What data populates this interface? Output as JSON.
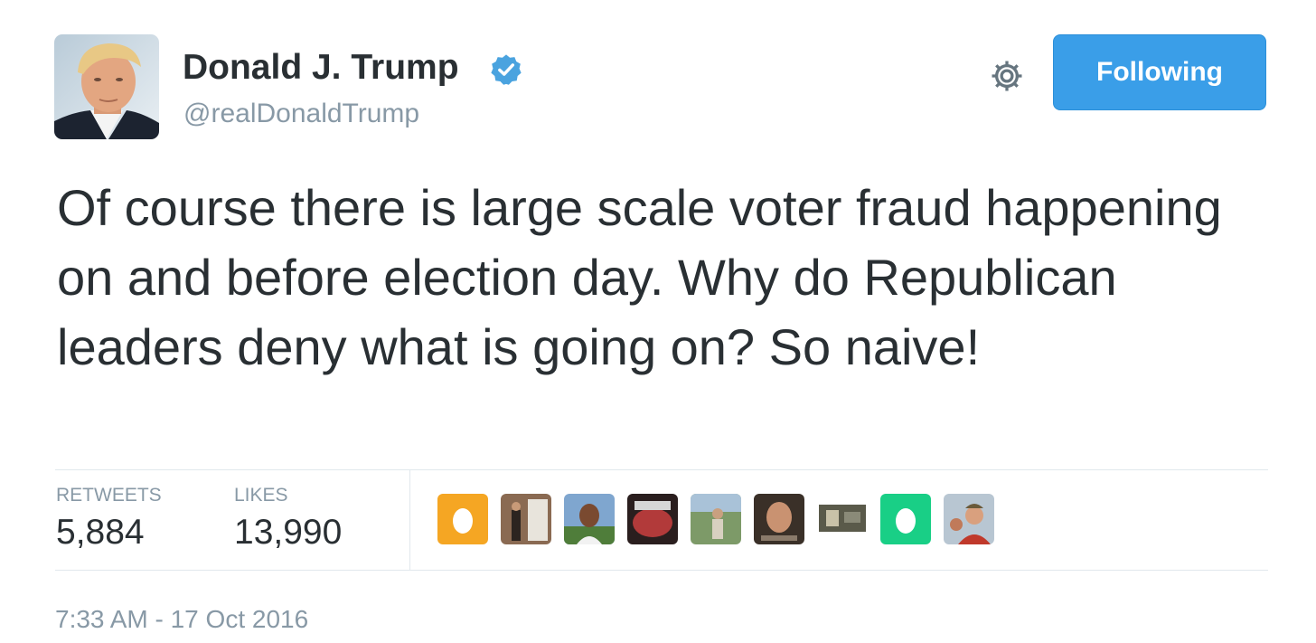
{
  "user": {
    "display_name": "Donald J. Trump",
    "handle": "@realDonaldTrump",
    "verified": true,
    "avatar_icon": "profile-photo"
  },
  "actions": {
    "settings_icon": "gear-icon",
    "follow_label": "Following"
  },
  "tweet": {
    "text": "Of course there is large scale voter fraud happening on and before election day. Why do Republican leaders deny what is going on? So naive!"
  },
  "stats": {
    "retweets_label": "RETWEETS",
    "retweets_value": "5,884",
    "likes_label": "LIKES",
    "likes_value": "13,990"
  },
  "likers": [
    {
      "icon": "default-egg-avatar",
      "color": "#f5a623"
    },
    {
      "icon": "user-photo-avatar",
      "color": "#8a6a52"
    },
    {
      "icon": "user-photo-avatar",
      "color": "#6b8bb0"
    },
    {
      "icon": "user-photo-avatar",
      "color": "#b23a3a"
    },
    {
      "icon": "user-photo-avatar",
      "color": "#6f8a5c"
    },
    {
      "icon": "user-photo-avatar",
      "color": "#5a4a3a"
    },
    {
      "icon": "user-photo-avatar",
      "color": "#7a7a6a"
    },
    {
      "icon": "default-egg-avatar",
      "color": "#19cf86"
    },
    {
      "icon": "user-photo-avatar",
      "color": "#c0392b"
    }
  ],
  "timestamp": "7:33 AM - 17 Oct 2016",
  "colors": {
    "accent": "#3a9ee8",
    "text": "#292f33",
    "muted": "#8899a6",
    "divider": "#e1e8ed"
  }
}
